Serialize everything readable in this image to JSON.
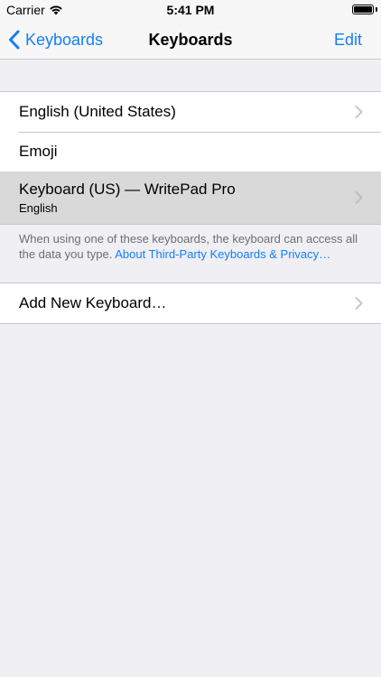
{
  "status_bar": {
    "carrier": "Carrier",
    "time": "5:41 PM",
    "wifi_icon": "wifi-icon",
    "battery_icon": "battery-icon"
  },
  "nav": {
    "back_label": "Keyboards",
    "title": "Keyboards",
    "edit_label": "Edit"
  },
  "keyboards": [
    {
      "title": "English (United States)",
      "has_chevron": true
    },
    {
      "title": "Emoji",
      "has_chevron": false
    },
    {
      "title": "Keyboard (US) — WritePad Pro",
      "subtitle": "English",
      "has_chevron": true,
      "highlighted": true
    }
  ],
  "footer": {
    "text": "When using one of these keyboards, the keyboard can access all the data you type. ",
    "link": "About Third-Party Keyboards & Privacy…"
  },
  "add_keyboard": {
    "label": "Add New Keyboard…"
  },
  "colors": {
    "accent": "#147efb",
    "background": "#efeff4",
    "cell_background": "#ffffff",
    "highlight": "#d9d9d9",
    "separator": "#c8c7cc",
    "secondary_text": "#6d6d72"
  }
}
